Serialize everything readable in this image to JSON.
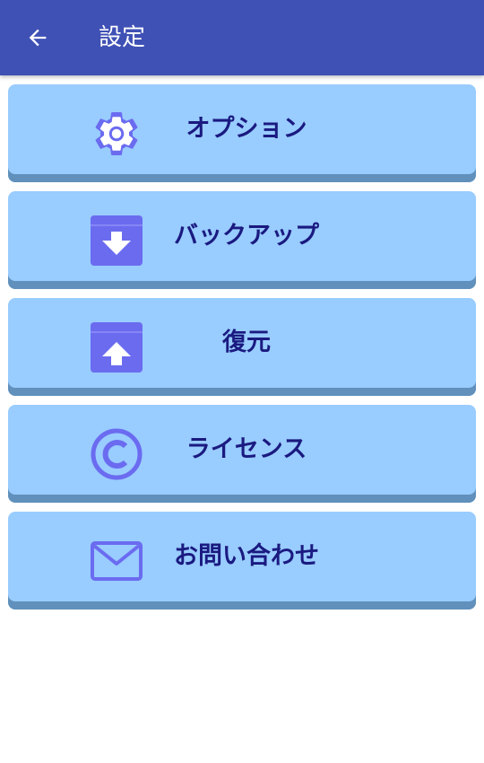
{
  "appbar": {
    "title": "設定",
    "back_icon": "arrow-back-icon",
    "color": "#3f51b5"
  },
  "menu": {
    "items": [
      {
        "label": "オプション",
        "icon": "gear-icon"
      },
      {
        "label": "バックアップ",
        "icon": "archive-download-icon"
      },
      {
        "label": "復元",
        "icon": "archive-upload-icon"
      },
      {
        "label": "ライセンス",
        "icon": "copyright-icon"
      },
      {
        "label": "お問い合わせ",
        "icon": "mail-icon"
      }
    ],
    "item_color": "#99ccff",
    "icon_color": "#6666ee",
    "text_color": "#1a1a80"
  }
}
